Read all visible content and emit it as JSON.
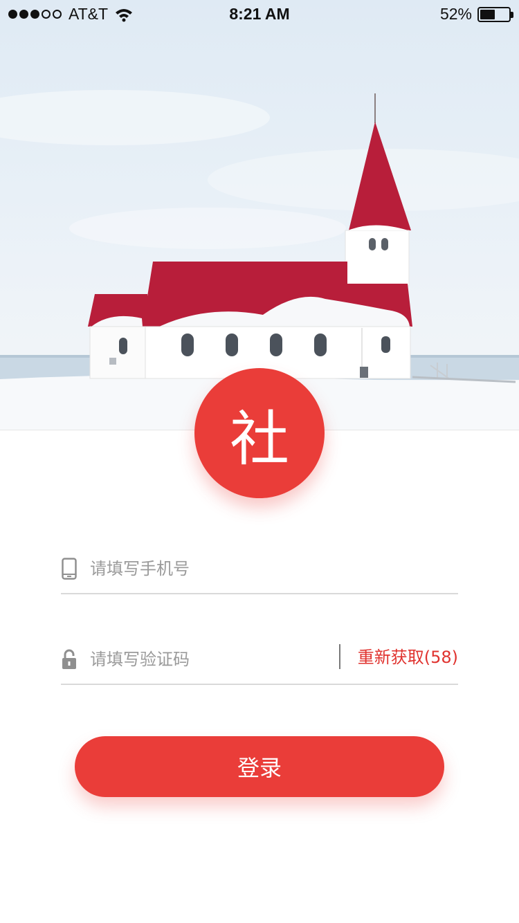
{
  "status_bar": {
    "carrier": "AT&T",
    "time": "8:21 AM",
    "battery_percent": "52%",
    "battery_level": 0.52,
    "signal_bars_filled": 3,
    "signal_bars_total": 5
  },
  "logo": {
    "character": "社",
    "color": "#ea3d39"
  },
  "form": {
    "phone": {
      "placeholder": "请填写手机号",
      "value": "",
      "icon": "phone-icon"
    },
    "code": {
      "placeholder": "请填写验证码",
      "value": "",
      "icon": "lock-icon",
      "resend_label": "重新获取(58)"
    },
    "login_label": "登录"
  },
  "colors": {
    "accent": "#ea3d39",
    "resend_text": "#e0332f",
    "placeholder": "#9a9a9a",
    "underline": "#d9d9d9"
  }
}
